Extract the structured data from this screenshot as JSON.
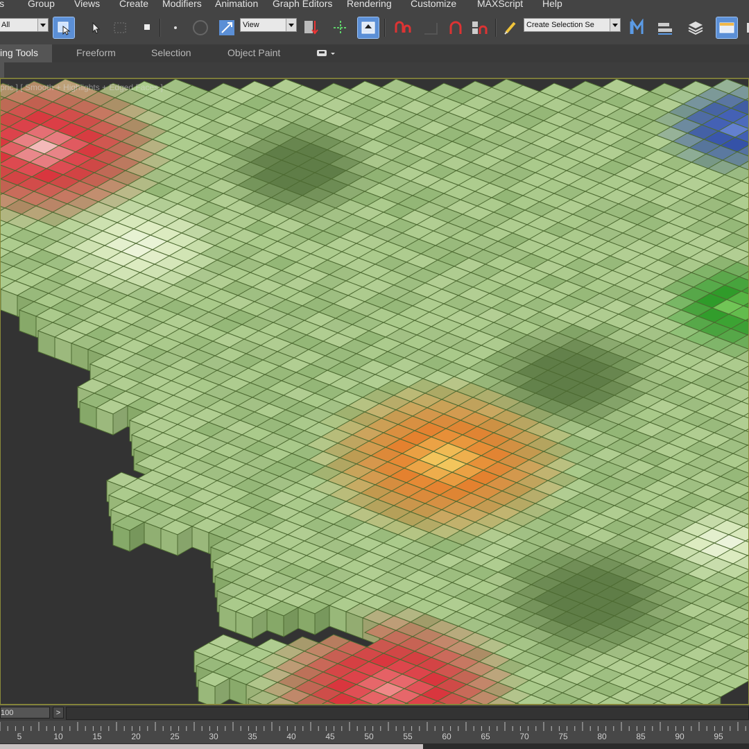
{
  "menu": [
    "ls",
    "Group",
    "Views",
    "Create",
    "Modifiers",
    "Animation",
    "Graph Editors",
    "Rendering",
    "Customize",
    "MAXScript",
    "Help"
  ],
  "toolbar": {
    "filter_value": "All",
    "ref_coord_value": "View",
    "selection_set_value": "Create Selection Se",
    "icons": [
      "select-object-icon",
      "select-cursor-icon",
      "region-select-icon",
      "window-crossing-icon",
      "move-icon",
      "rotate-icon",
      "scale-icon",
      "ref-coord-icon",
      "pivot-center-icon",
      "select-manipulate-icon",
      "keyboard-shortcut-icon",
      "snap-2d-icon",
      "snap-angle-icon",
      "snap-percent-icon",
      "spinner-snap-icon",
      "edit-named-sets-icon",
      "mirror-icon",
      "align-icon",
      "layer-manager-icon",
      "graphite-ribbon-icon",
      "render-setup-icon"
    ]
  },
  "ribbon": {
    "tabs": [
      "ing Tools",
      "Freeform",
      "Selection",
      "Object Paint"
    ],
    "options_icon": "ribbon-options-icon"
  },
  "viewport": {
    "label": "pric ] [ Smooth + Highlights + Edged Faces ]",
    "scene": "voxel-heightmap-grid",
    "colors": {
      "ground_light": "#a9c98a",
      "ground_mid": "#93b676",
      "ground_dark": "#5f7d47",
      "edge": "#4d6a31",
      "hot_red": "#d9363e",
      "hot_orange": "#e4812f",
      "hot_yellow": "#f6d868",
      "cold_blue": "#3552a8",
      "bright_green": "#2f9b2a",
      "background": "#333333"
    }
  },
  "timeslider": {
    "counter": "100",
    "next_label": ">"
  },
  "trackbar": {
    "ticks": [
      "5",
      "10",
      "15",
      "20",
      "25",
      "30",
      "35",
      "40",
      "45",
      "50",
      "55",
      "60",
      "65",
      "70",
      "75",
      "80",
      "85",
      "90",
      "95"
    ]
  }
}
